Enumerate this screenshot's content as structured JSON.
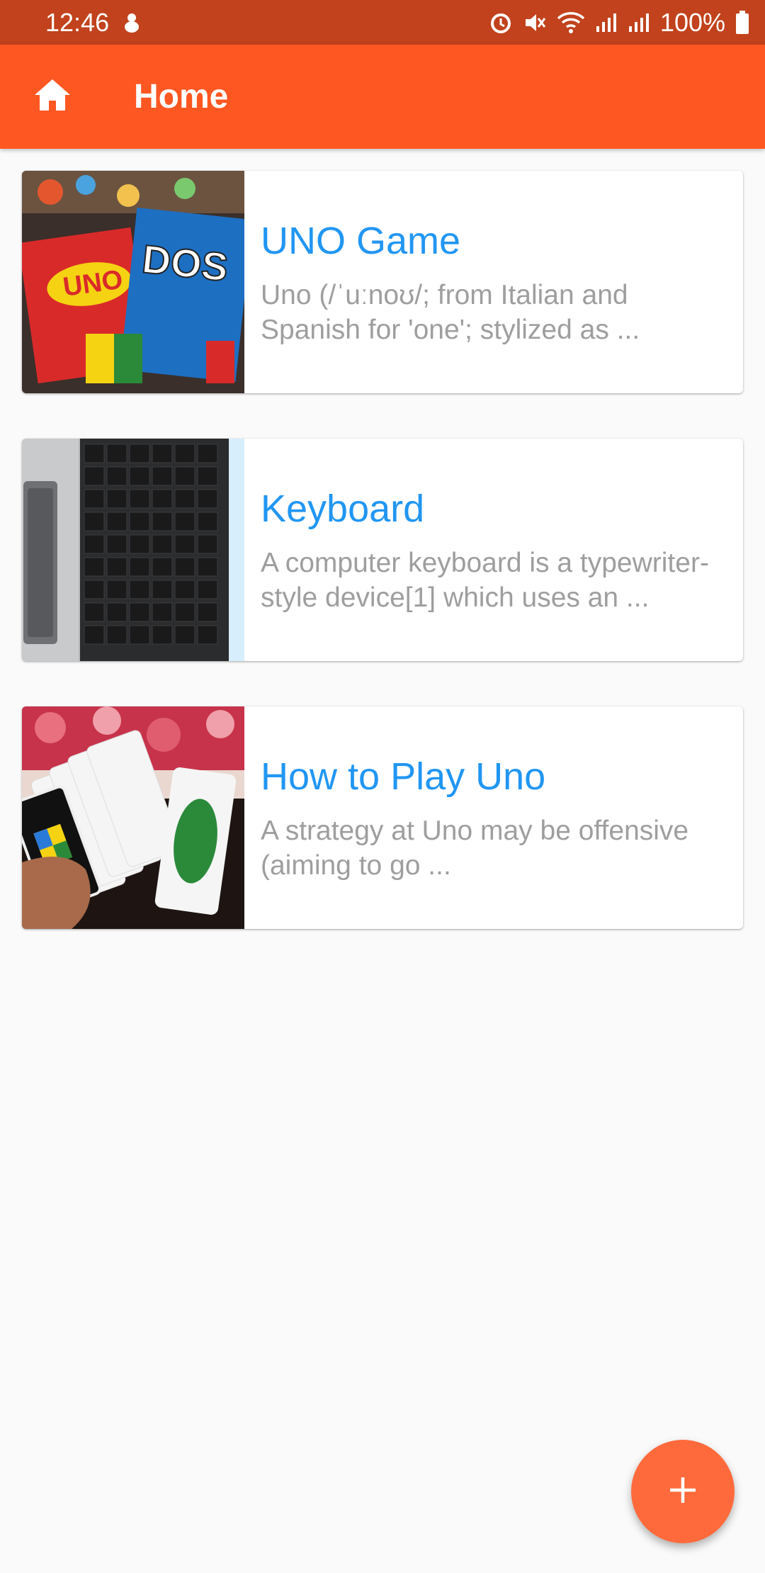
{
  "status_bar": {
    "time": "12:46",
    "battery": "100%",
    "icons": [
      "notification-icon",
      "alarm-icon",
      "mute-icon",
      "wifi-icon",
      "signal-icon",
      "signal-icon",
      "battery-icon"
    ]
  },
  "app_bar": {
    "title": "Home",
    "nav_icon": "home-icon"
  },
  "items": [
    {
      "title": "UNO Game",
      "description": "Uno (/ˈuːnoʊ/; from Italian and Spanish for 'one'; stylized as ..."
    },
    {
      "title": "Keyboard",
      "description": "A computer keyboard is a typewriter-style device[1] which uses an ..."
    },
    {
      "title": "How to Play Uno",
      "description": "A strategy at Uno may be offensive (aiming to go ..."
    }
  ],
  "fab": {
    "icon": "plus-icon"
  },
  "colors": {
    "status_bar": "#c1421c",
    "app_bar": "#ff5722",
    "title_blue": "#2196f3",
    "desc_gray": "#9e9e9e",
    "fab": "#ff6a3c"
  }
}
